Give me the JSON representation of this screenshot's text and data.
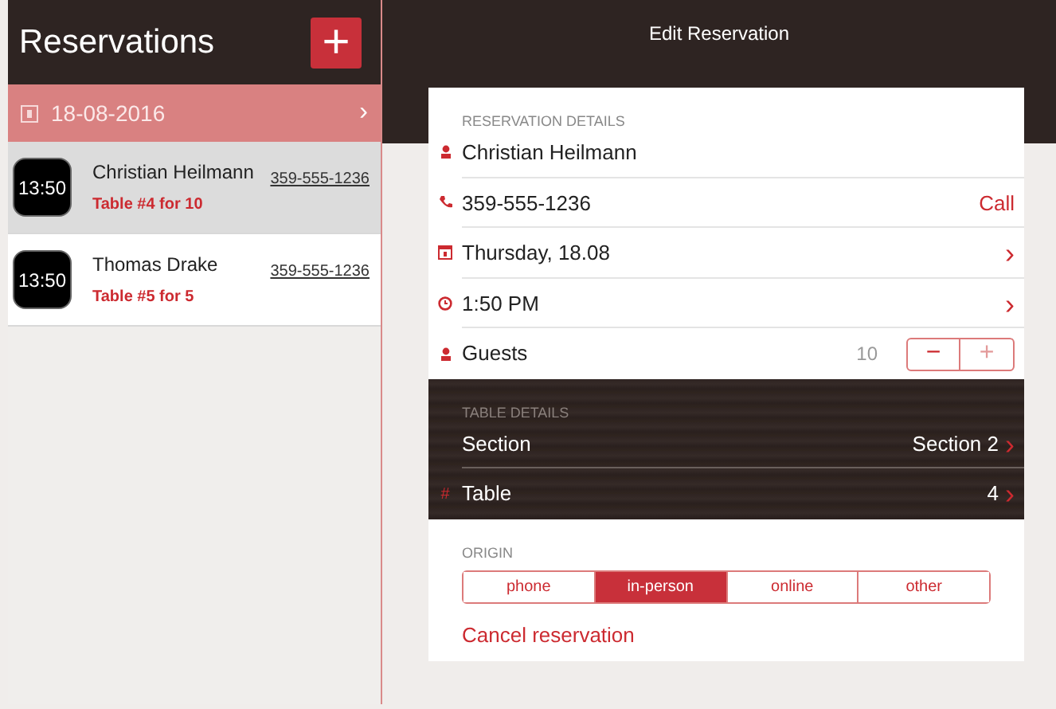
{
  "sidebar": {
    "title": "Reservations",
    "add_button": "+",
    "date": "18-08-2016",
    "date_chevron": "›",
    "reservations": [
      {
        "time": "13:50",
        "name": "Christian Heilmann",
        "phone": "359-555-1236",
        "table": "Table #4 for 10",
        "selected": true
      },
      {
        "time": "13:50",
        "name": "Thomas Drake",
        "phone": "359-555-1236",
        "table": "Table #5 for 5",
        "selected": false
      }
    ]
  },
  "detail": {
    "title": "Edit Reservation",
    "reservation_section": {
      "heading": "RESERVATION DETAILS",
      "rows": [
        {
          "kind": "person",
          "label": "Christian Heilmann"
        },
        {
          "kind": "phone",
          "label": "359-555-1236",
          "action": "Call"
        },
        {
          "kind": "date",
          "label": "Thursday, 18.08",
          "chevron": "›"
        },
        {
          "kind": "time",
          "label": "1:50 PM",
          "chevron": "›"
        },
        {
          "kind": "guests",
          "label": "Guests",
          "value": "10",
          "minus": "−",
          "plus": "+"
        }
      ]
    },
    "table_section": {
      "heading": "TABLE DETAILS",
      "rows": [
        {
          "label": "Section",
          "value": "Section 2",
          "chevron": "›"
        },
        {
          "label": "Table",
          "icon": "#",
          "value": "4",
          "chevron": "›"
        }
      ]
    },
    "origin": {
      "heading": "ORIGIN",
      "options": [
        {
          "label": "phone",
          "selected": false
        },
        {
          "label": "in-person",
          "selected": true
        },
        {
          "label": "online",
          "selected": false
        },
        {
          "label": "other",
          "selected": false
        }
      ]
    },
    "cancel": "Cancel reservation"
  }
}
